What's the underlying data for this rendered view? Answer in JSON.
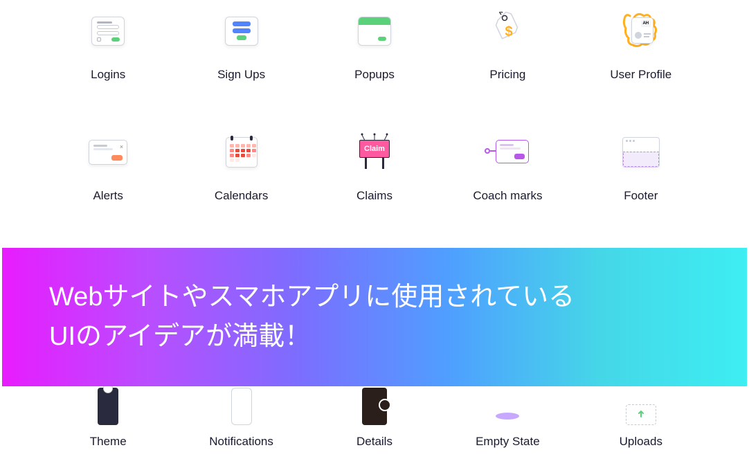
{
  "items": [
    {
      "label": "Logins",
      "name": "logins"
    },
    {
      "label": "Sign Ups",
      "name": "sign-ups"
    },
    {
      "label": "Popups",
      "name": "popups"
    },
    {
      "label": "Pricing",
      "name": "pricing"
    },
    {
      "label": "User Profile",
      "name": "user-profile"
    },
    {
      "label": "Alerts",
      "name": "alerts"
    },
    {
      "label": "Calendars",
      "name": "calendars"
    },
    {
      "label": "Claims",
      "name": "claims"
    },
    {
      "label": "Coach marks",
      "name": "coach-marks"
    },
    {
      "label": "Footer",
      "name": "footer"
    },
    {
      "label": "Theme",
      "name": "theme"
    },
    {
      "label": "Notifications",
      "name": "notifications"
    },
    {
      "label": "Details",
      "name": "details"
    },
    {
      "label": "Empty State",
      "name": "empty-state"
    },
    {
      "label": "Uploads",
      "name": "uploads"
    }
  ],
  "banner": {
    "line1": "Webサイトやスマホアプリに使用されている",
    "line2": "UIのアイデアが満載！"
  },
  "claims_text": "Claim",
  "profile_initials": "AH"
}
